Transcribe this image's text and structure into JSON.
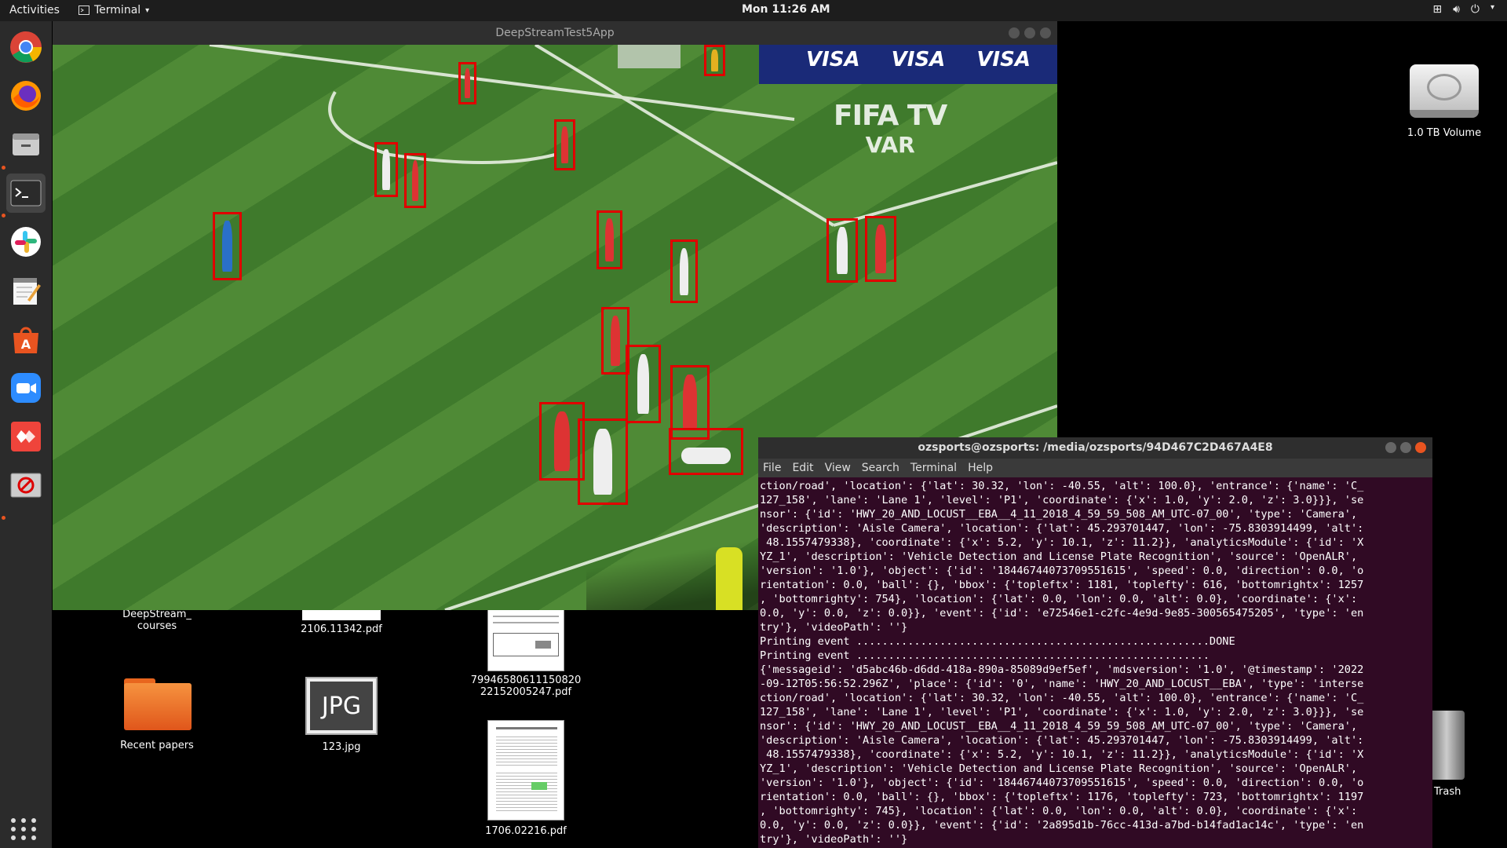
{
  "topbar": {
    "activities": "Activities",
    "app_menu": "Terminal",
    "clock": "Mon 11:26 AM"
  },
  "dock": {
    "items": [
      "chrome-icon",
      "firefox-icon",
      "files-icon",
      "terminal-icon",
      "slack-icon",
      "text-editor-icon",
      "software-center-icon",
      "zoom-icon",
      "anydesk-icon",
      "stop-icon"
    ]
  },
  "desktop": {
    "icons": [
      {
        "label": "DeepStream_\ncourses"
      },
      {
        "label": "2106.11342.pdf"
      },
      {
        "label": "79946580611150820\n22152005247.pdf"
      },
      {
        "label": "Recent papers"
      },
      {
        "label": "123.jpg",
        "badge": "JPG"
      },
      {
        "label": "1706.02216.pdf"
      },
      {
        "label": "1.0 TB Volume"
      },
      {
        "label": "Trash"
      }
    ]
  },
  "video_window": {
    "title": "DeepStreamTest5App",
    "overlay": {
      "brand": "FIFA TV",
      "sub": "VAR",
      "ads": [
        "VISA",
        "VISA",
        "VISA"
      ]
    }
  },
  "terminal": {
    "title": "ozsports@ozsports: /media/ozsports/94D467C2D467A4E8",
    "menu": [
      "File",
      "Edit",
      "View",
      "Search",
      "Terminal",
      "Help"
    ],
    "lines": [
      "ction/road', 'location': {'lat': 30.32, 'lon': -40.55, 'alt': 100.0}, 'entrance': {'name': 'C_",
      "127_158', 'lane': 'Lane 1', 'level': 'P1', 'coordinate': {'x': 1.0, 'y': 2.0, 'z': 3.0}}}, 'se",
      "nsor': {'id': 'HWY_20_AND_LOCUST__EBA__4_11_2018_4_59_59_508_AM_UTC-07_00', 'type': 'Camera',",
      "'description': 'Aisle Camera', 'location': {'lat': 45.293701447, 'lon': -75.8303914499, 'alt':",
      " 48.1557479338}, 'coordinate': {'x': 5.2, 'y': 10.1, 'z': 11.2}}, 'analyticsModule': {'id': 'X",
      "YZ_1', 'description': 'Vehicle Detection and License Plate Recognition', 'source': 'OpenALR',",
      "'version': '1.0'}, 'object': {'id': '18446744073709551615', 'speed': 0.0, 'direction': 0.0, 'o",
      "rientation': 0.0, 'ball': {}, 'bbox': {'topleftx': 1181, 'toplefty': 616, 'bottomrightx': 1257",
      ", 'bottomrighty': 754}, 'location': {'lat': 0.0, 'lon': 0.0, 'alt': 0.0}, 'coordinate': {'x':",
      "0.0, 'y': 0.0, 'z': 0.0}}, 'event': {'id': 'e72546e1-c2fc-4e9d-9e85-300565475205', 'type': 'en",
      "try'}, 'videoPath': ''}",
      "Printing event .......................................................DONE",
      "Printing event .......................................................",
      "{'messageid': 'd5abc46b-d6dd-418a-890a-85089d9ef5ef', 'mdsversion': '1.0', '@timestamp': '2022",
      "-09-12T05:56:52.296Z', 'place': {'id': '0', 'name': 'HWY_20_AND_LOCUST__EBA', 'type': 'interse",
      "ction/road', 'location': {'lat': 30.32, 'lon': -40.55, 'alt': 100.0}, 'entrance': {'name': 'C_",
      "127_158', 'lane': 'Lane 1', 'level': 'P1', 'coordinate': {'x': 1.0, 'y': 2.0, 'z': 3.0}}}, 'se",
      "nsor': {'id': 'HWY_20_AND_LOCUST__EBA__4_11_2018_4_59_59_508_AM_UTC-07_00', 'type': 'Camera',",
      "'description': 'Aisle Camera', 'location': {'lat': 45.293701447, 'lon': -75.8303914499, 'alt':",
      " 48.1557479338}, 'coordinate': {'x': 5.2, 'y': 10.1, 'z': 11.2}}, 'analyticsModule': {'id': 'X",
      "YZ_1', 'description': 'Vehicle Detection and License Plate Recognition', 'source': 'OpenALR',",
      "'version': '1.0'}, 'object': {'id': '18446744073709551615', 'speed': 0.0, 'direction': 0.0, 'o",
      "rientation': 0.0, 'ball': {}, 'bbox': {'topleftx': 1176, 'toplefty': 723, 'bottomrightx': 1197",
      ", 'bottomrighty': 745}, 'location': {'lat': 0.0, 'lon': 0.0, 'alt': 0.0}, 'coordinate': {'x':",
      "0.0, 'y': 0.0, 'z': 0.0}}, 'event': {'id': '2a895d1b-76cc-413d-a7bd-b14fad1ac14c', 'type': 'en",
      "try'}, 'videoPath': ''}"
    ]
  },
  "colors": {
    "bbox": "#e00000",
    "terminal_bg": "#300a24",
    "accent": "#e95420"
  }
}
